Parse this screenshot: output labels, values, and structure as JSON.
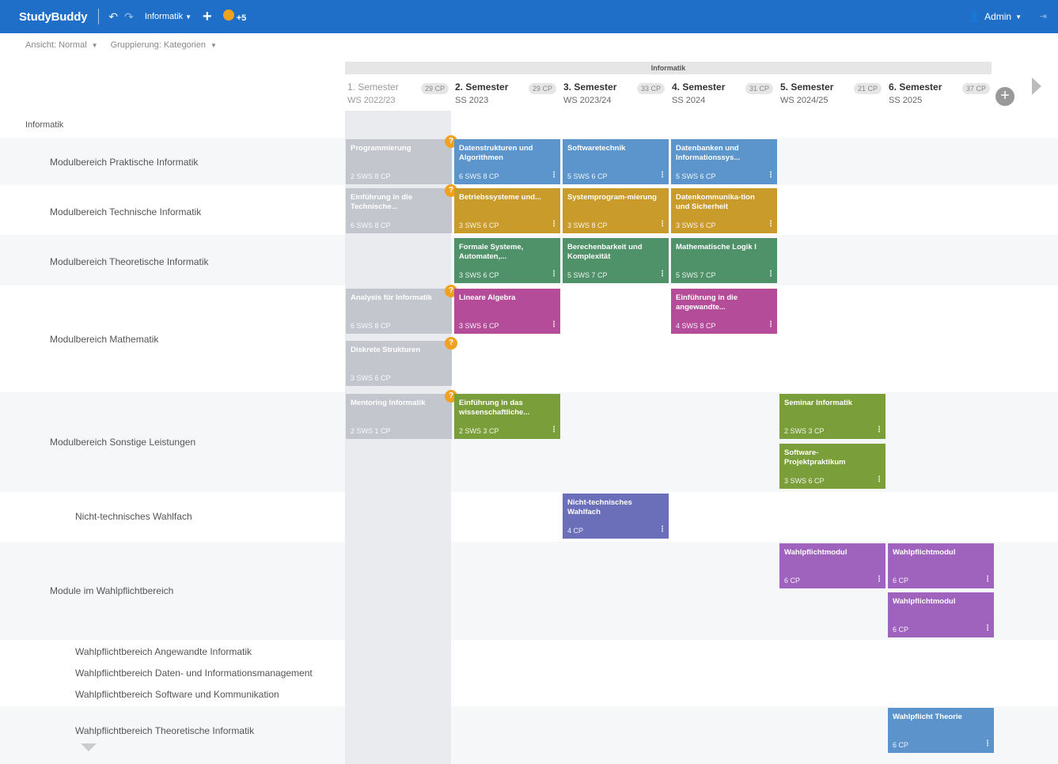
{
  "app": {
    "name": "StudyBuddy",
    "program": "Informatik",
    "badge_count": "+5",
    "user": "Admin",
    "logout_icon": "logout-icon"
  },
  "options": {
    "view": "Ansicht: Normal",
    "grouping": "Gruppierung: Kategorien"
  },
  "header": {
    "program_title": "Informatik"
  },
  "semesters": [
    {
      "title": "1. Semester",
      "sub": "WS 2022/23",
      "cp": "29 CP"
    },
    {
      "title": "2. Semester",
      "sub": "SS 2023",
      "cp": "29 CP"
    },
    {
      "title": "3. Semester",
      "sub": "WS 2023/24",
      "cp": "33 CP"
    },
    {
      "title": "4. Semester",
      "sub": "SS 2024",
      "cp": "31 CP"
    },
    {
      "title": "5. Semester",
      "sub": "WS 2024/25",
      "cp": "21 CP"
    },
    {
      "title": "6. Semester",
      "sub": "SS 2025",
      "cp": "37 CP"
    }
  ],
  "rows": [
    "Informatik",
    "Modulbereich Praktische Informatik",
    "Modulbereich Technische Informatik",
    "Modulbereich Theoretische Informatik",
    "Modulbereich Mathematik",
    "Modulbereich Sonstige Leistungen",
    "Nicht-technisches Wahlfach",
    "Module im Wahlpflichtbereich",
    "Wahlpflichtbereich Angewandte Informatik",
    "Wahlpflichtbereich Daten- und Informationsmanagement",
    "Wahlpflichtbereich Software und Kommunikation",
    "Wahlpflichtbereich Theoretische Informatik"
  ],
  "cards": [
    {
      "name": "Programmierung",
      "meta": "2 SWS 8 CP"
    },
    {
      "name": "Datenstrukturen und Algorithmen",
      "meta": "6 SWS 8 CP"
    },
    {
      "name": "Softwaretechnik",
      "meta": "5 SWS 6 CP"
    },
    {
      "name": "Datenbanken und Informationssys...",
      "meta": "5 SWS 6 CP"
    },
    {
      "name": "Einführung in die Technische...",
      "meta": "6 SWS 8 CP"
    },
    {
      "name": "Betriebssysteme und...",
      "meta": "3 SWS 6 CP"
    },
    {
      "name": "Systemprogram-mierung",
      "meta": "3 SWS 8 CP"
    },
    {
      "name": "Datenkommunika-tion und Sicherheit",
      "meta": "3 SWS 6 CP"
    },
    {
      "name": "Formale Systeme, Automaten,...",
      "meta": "3 SWS 6 CP"
    },
    {
      "name": "Berechenbarkeit und Komplexität",
      "meta": "5 SWS 7 CP"
    },
    {
      "name": "Mathematische Logik I",
      "meta": "5 SWS 7 CP"
    },
    {
      "name": "Analysis für Informatik",
      "meta": "6 SWS 8 CP"
    },
    {
      "name": "Lineare Algebra",
      "meta": "3 SWS 6 CP"
    },
    {
      "name": "Einführung in die angewandte...",
      "meta": "4 SWS 8 CP"
    },
    {
      "name": "Diskrete Strukturen",
      "meta": "3 SWS 6 CP"
    },
    {
      "name": "Mentoring Informatik",
      "meta": "2 SWS 1 CP"
    },
    {
      "name": "Einführung in das wissenschaftliche...",
      "meta": "2 SWS 3 CP"
    },
    {
      "name": "Seminar Informatik",
      "meta": "2 SWS 3 CP"
    },
    {
      "name": "Software-Projektpraktikum",
      "meta": "3 SWS 6 CP"
    },
    {
      "name": "Nicht-technisches Wahlfach",
      "meta": "4 CP"
    },
    {
      "name": "Wahlpflichtmodul",
      "meta": "6 CP"
    },
    {
      "name": "Wahlpflichtmodul",
      "meta": "6 CP"
    },
    {
      "name": "Wahlpflichtmodul",
      "meta": "6 CP"
    },
    {
      "name": "Wahlpflicht Theorie",
      "meta": "6 CP"
    }
  ],
  "colors": {
    "topbar": "#1f6fc8",
    "blue": "#5b95cc",
    "gold": "#c89b2a",
    "teal": "#4f9169",
    "pink": "#b54c9a",
    "olive": "#7a9e3a",
    "indigo": "#6b6eb8",
    "purple": "#a063bd",
    "warning": "#f0a21e"
  }
}
